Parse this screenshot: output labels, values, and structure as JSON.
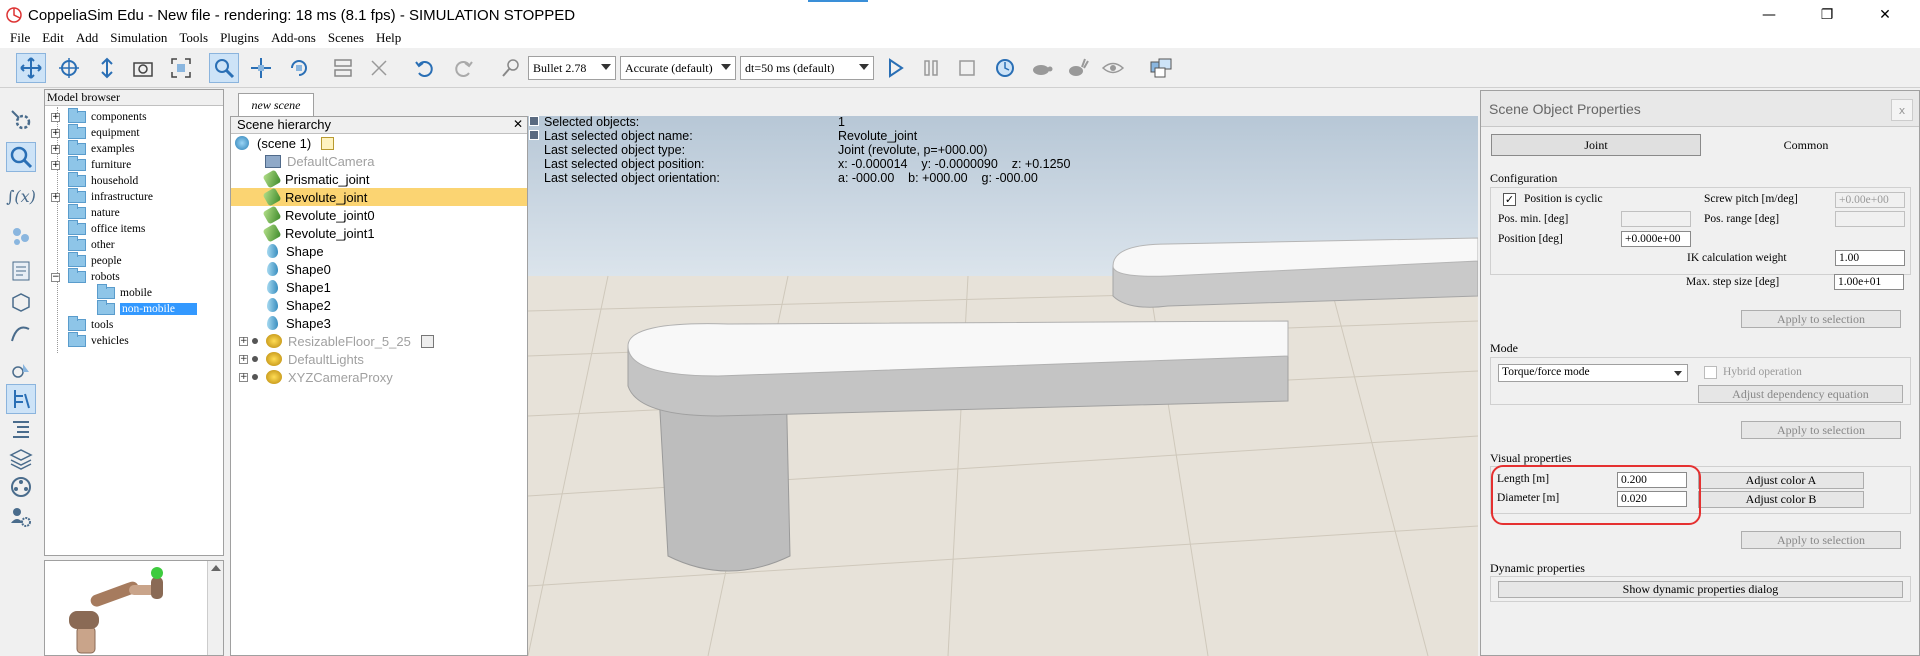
{
  "window": {
    "title": "CoppeliaSim Edu - New file - rendering: 18 ms (8.1 fps) - SIMULATION STOPPED"
  },
  "menu": [
    "File",
    "Edit",
    "Add",
    "Simulation",
    "Tools",
    "Plugins",
    "Add-ons",
    "Scenes",
    "Help"
  ],
  "toolbar": {
    "engine": "Bullet 2.78",
    "accuracy": "Accurate (default)",
    "dt": "dt=50 ms (default)"
  },
  "model_browser": {
    "header": "Model browser",
    "items": [
      {
        "label": "components",
        "expandable": true
      },
      {
        "label": "equipment",
        "expandable": true
      },
      {
        "label": "examples",
        "expandable": true
      },
      {
        "label": "furniture",
        "expandable": true
      },
      {
        "label": "household",
        "expandable": false
      },
      {
        "label": "infrastructure",
        "expandable": true
      },
      {
        "label": "nature",
        "expandable": false
      },
      {
        "label": "office items",
        "expandable": false
      },
      {
        "label": "other",
        "expandable": false
      },
      {
        "label": "people",
        "expandable": false
      },
      {
        "label": "robots",
        "expandable": true
      },
      {
        "label": "mobile",
        "expandable": false
      },
      {
        "label": "non-mobile",
        "expandable": false
      },
      {
        "label": "tools",
        "expandable": false
      },
      {
        "label": "vehicles",
        "expandable": false
      }
    ]
  },
  "scene_tab": "new scene",
  "hierarchy": {
    "header": "Scene hierarchy",
    "close": "✕",
    "items": [
      {
        "label": "(scene 1)"
      },
      {
        "label": "DefaultCamera"
      },
      {
        "label": "Prismatic_joint"
      },
      {
        "label": "Revolute_joint"
      },
      {
        "label": "Revolute_joint0"
      },
      {
        "label": "Revolute_joint1"
      },
      {
        "label": "Shape"
      },
      {
        "label": "Shape0"
      },
      {
        "label": "Shape1"
      },
      {
        "label": "Shape2"
      },
      {
        "label": "Shape3"
      },
      {
        "label": "ResizableFloor_5_25"
      },
      {
        "label": "DefaultLights"
      },
      {
        "label": "XYZCameraProxy"
      }
    ]
  },
  "viewport_info": {
    "labels": [
      "Selected objects:",
      "Last selected object name:",
      "Last selected object type:",
      "Last selected object position:",
      "Last selected object orientation:"
    ],
    "values": [
      "1",
      "Revolute_joint",
      "Joint (revolute, p=+000.00)",
      "x: -0.000014    y: -0.0000090    z: +0.1250",
      "a: -000.00    b: +000.00    g: -000.00"
    ]
  },
  "props": {
    "title": "Scene Object Properties",
    "close": "x",
    "tabs": [
      "Joint",
      "Common"
    ],
    "config": {
      "title": "Configuration",
      "cyclic_label": "Position is cyclic",
      "cyclic_check": "✓",
      "screw_label": "Screw pitch [m/deg]",
      "screw_value": "+0.00e+00",
      "posmin_label": "Pos. min. [deg]",
      "posmin_value": "",
      "posrange_label": "Pos. range [deg]",
      "posrange_value": "",
      "position_label": "Position [deg]",
      "position_value": "+0.000e+00",
      "ik_label": "IK calculation weight",
      "ik_value": "1.00",
      "maxstep_label": "Max. step size [deg]",
      "maxstep_value": "1.00e+01",
      "apply": "Apply to selection"
    },
    "mode": {
      "title": "Mode",
      "selected": "Torque/force mode",
      "hybrid_label": "Hybrid operation",
      "adjust_dep": "Adjust dependency equation",
      "apply": "Apply to selection"
    },
    "visual": {
      "title": "Visual properties",
      "length_label": "Length [m]",
      "length_value": "0.200",
      "diameter_label": "Diameter [m]",
      "diameter_value": "0.020",
      "color_a": "Adjust color A",
      "color_b": "Adjust color B",
      "apply": "Apply to selection"
    },
    "dynamic": {
      "title": "Dynamic properties",
      "button": "Show dynamic properties dialog"
    }
  }
}
